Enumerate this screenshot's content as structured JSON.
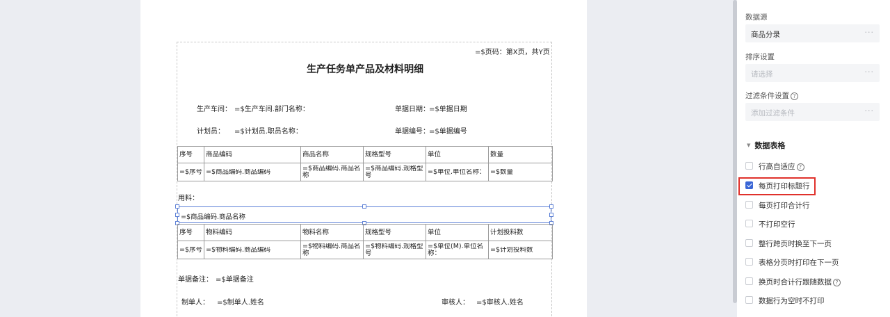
{
  "report": {
    "page_number": "=$页码：第X页，共Y页",
    "title": "生产任务单产品及材料明细",
    "workshop_label": "生产车间：",
    "workshop_value": "=$生产车间.部门名称：",
    "doc_date_label": "单据日期：",
    "doc_date_value": "=$单据日期",
    "planner_label": "计划员：",
    "planner_value": "=$计划员.职员名称：",
    "doc_no_label": "单据编号：",
    "doc_no_value": "=$单据编号",
    "product_table": {
      "headers": [
        "序号",
        "商品编码",
        "商品名称",
        "规格型号",
        "单位",
        "数量"
      ],
      "row": [
        "=$序号",
        "=$商品编码.商品编码",
        "=$商品编码.商品名称",
        "=$商品编码.规格型号",
        "=$单位.单位名称：",
        "=$数量"
      ]
    },
    "material_label": "用料：",
    "selected_band_text": "=$商品编码.商品名称",
    "material_table": {
      "headers": [
        "序号",
        "物料编码",
        "物料名称",
        "规格型号",
        "单位",
        "计划投料数"
      ],
      "row": [
        "=$序号",
        "=$物料编码.商品编码",
        "=$物料编码.商品名称",
        "=$物料编码.规格型号",
        "=$单位(M).单位名称：",
        "=$计划投料数"
      ]
    },
    "remark_label": "单据备注：",
    "remark_value": "=$单据备注",
    "maker_label": "制单人：",
    "maker_value": "=$制单人.姓名",
    "reviewer_label": "审核人：",
    "reviewer_value": "=$审核人.姓名"
  },
  "panel": {
    "datasource_label": "数据源",
    "datasource_value": "商品分录",
    "sort_label": "排序设置",
    "sort_placeholder": "请选择",
    "filter_label": "过滤条件设置",
    "filter_placeholder": "添加过滤条件",
    "more_glyph": "···",
    "help_glyph": "?",
    "section_title": "数据表格",
    "options": [
      {
        "label": "行高自适应",
        "checked": false,
        "help": true
      },
      {
        "label": "每页打印标题行",
        "checked": true,
        "help": false
      },
      {
        "label": "每页打印合计行",
        "checked": false,
        "help": false
      },
      {
        "label": "不打印空行",
        "checked": false,
        "help": false
      },
      {
        "label": "整行跨页时换至下一页",
        "checked": false,
        "help": false
      },
      {
        "label": "表格分页时打印在下一页",
        "checked": false,
        "help": false
      },
      {
        "label": "换页时合计行跟随数据",
        "checked": false,
        "help": true
      },
      {
        "label": "数据行为空时不打印",
        "checked": false,
        "help": false
      }
    ],
    "colors": {
      "accent": "#3a66d6",
      "highlight": "#e0312b",
      "selection": "#5b7fd6"
    }
  }
}
